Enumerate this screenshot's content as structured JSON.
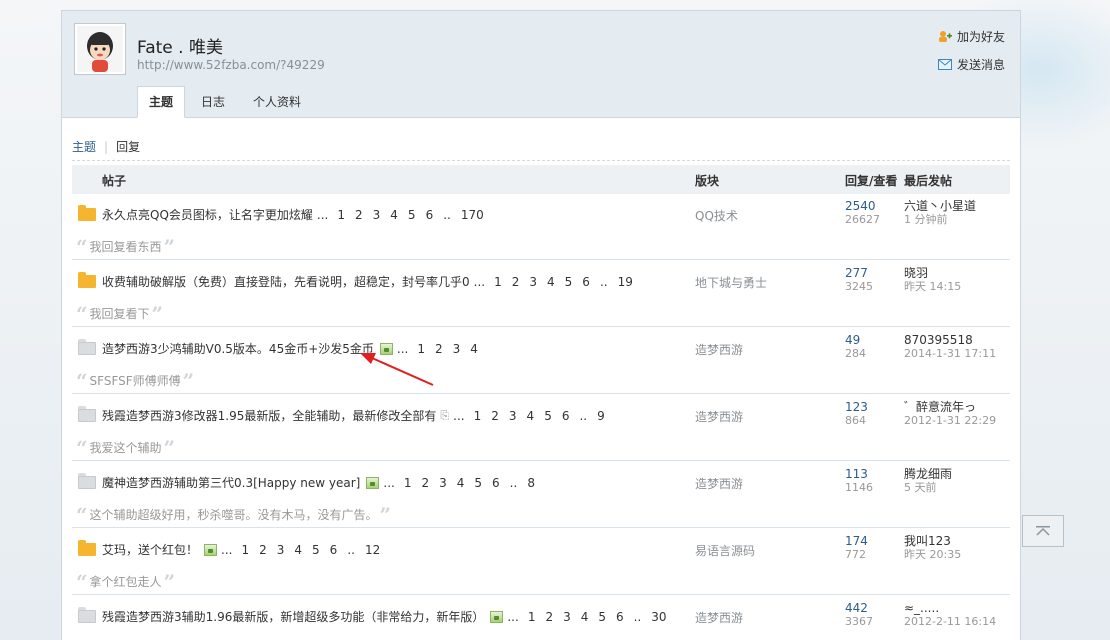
{
  "profile": {
    "username": "Fate . 唯美",
    "url": "http://www.52fzba.com/?49229",
    "add_friend": "加为好友",
    "send_message": "发送消息",
    "tabs": [
      {
        "label": "主题",
        "active": true
      },
      {
        "label": "日志",
        "active": false
      },
      {
        "label": "个人资料",
        "active": false
      }
    ]
  },
  "subnav": {
    "topics": "主题",
    "replies": "回复"
  },
  "table_header": {
    "post": "帖子",
    "forum": "版块",
    "reply_view": "回复/查看",
    "last_post": "最后发帖"
  },
  "rows": [
    {
      "folder": "orange",
      "title": "永久点亮QQ会员图标，让名字更加炫耀",
      "pages": [
        "1",
        "2",
        "3",
        "4",
        "5",
        "6",
        "..",
        "170"
      ],
      "image": false,
      "attach": false,
      "forum": "QQ技术",
      "replies": "2540",
      "views": "26627",
      "last_user": "六道丶小星道",
      "last_time": "1 分钟前",
      "quote": "我回复看东西"
    },
    {
      "folder": "orange",
      "title": "收费辅助破解版（免费）直接登陆，先看说明，超稳定，封号率几乎0",
      "pages": [
        "1",
        "2",
        "3",
        "4",
        "5",
        "6",
        "..",
        "19"
      ],
      "image": false,
      "attach": false,
      "forum": "地下城与勇士",
      "replies": "277",
      "views": "3245",
      "last_user": "晓羽",
      "last_time": "昨天 14:15",
      "quote": "我回复看下"
    },
    {
      "folder": "gray",
      "title": "造梦西游3少鸿辅助V0.5版本。45金币+沙发5金币",
      "pages": [
        "1",
        "2",
        "3",
        "4"
      ],
      "image": true,
      "attach": false,
      "forum": "造梦西游",
      "replies": "49",
      "views": "284",
      "last_user": "870395518",
      "last_time": "2014-1-31 17:11",
      "quote": "SFSFSF师傅师傅"
    },
    {
      "folder": "gray",
      "title": "残霞造梦西游3修改器1.95最新版，全能辅助，最新修改全部有",
      "pages": [
        "1",
        "2",
        "3",
        "4",
        "5",
        "6",
        "..",
        "9"
      ],
      "image": false,
      "attach": true,
      "forum": "造梦西游",
      "replies": "123",
      "views": "864",
      "last_user": "゛醉意流年っ",
      "last_time": "2012-1-31 22:29",
      "quote": "我爱这个辅助"
    },
    {
      "folder": "gray",
      "title": "魔神造梦西游辅助第三代0.3[Happy new year]",
      "pages": [
        "1",
        "2",
        "3",
        "4",
        "5",
        "6",
        "..",
        "8"
      ],
      "image": true,
      "attach": false,
      "forum": "造梦西游",
      "replies": "113",
      "views": "1146",
      "last_user": "腾龙细雨",
      "last_time": "5 天前",
      "quote": "这个辅助超级好用，秒杀噬哥。没有木马，没有广告。"
    },
    {
      "folder": "orange",
      "title": "艾玛，送个红包！",
      "pages": [
        "1",
        "2",
        "3",
        "4",
        "5",
        "6",
        "..",
        "12"
      ],
      "image": true,
      "attach": false,
      "forum": "易语言源码",
      "replies": "174",
      "views": "772",
      "last_user": "我叫123",
      "last_time": "昨天 20:35",
      "quote": "拿个红包走人"
    },
    {
      "folder": "gray",
      "title": "残霞造梦西游3辅助1.96最新版，新增超级多功能（非常给力，新年版）",
      "pages": [
        "1",
        "2",
        "3",
        "4",
        "5",
        "6",
        "..",
        "30"
      ],
      "image": true,
      "attach": false,
      "forum": "造梦西游",
      "replies": "442",
      "views": "3367",
      "last_user": "≈_.....",
      "last_time": "2012-2-11 16:14",
      "quote": ""
    }
  ],
  "colors": {
    "link": "#2b5d8c",
    "header_bg": "#e4ebf1",
    "folder_new": "#f5b52e",
    "arrow": "#e02020"
  },
  "icons": {
    "add_friend": "friend-add-icon",
    "send_message": "envelope-icon",
    "scroll_top": "scroll-top-icon"
  }
}
